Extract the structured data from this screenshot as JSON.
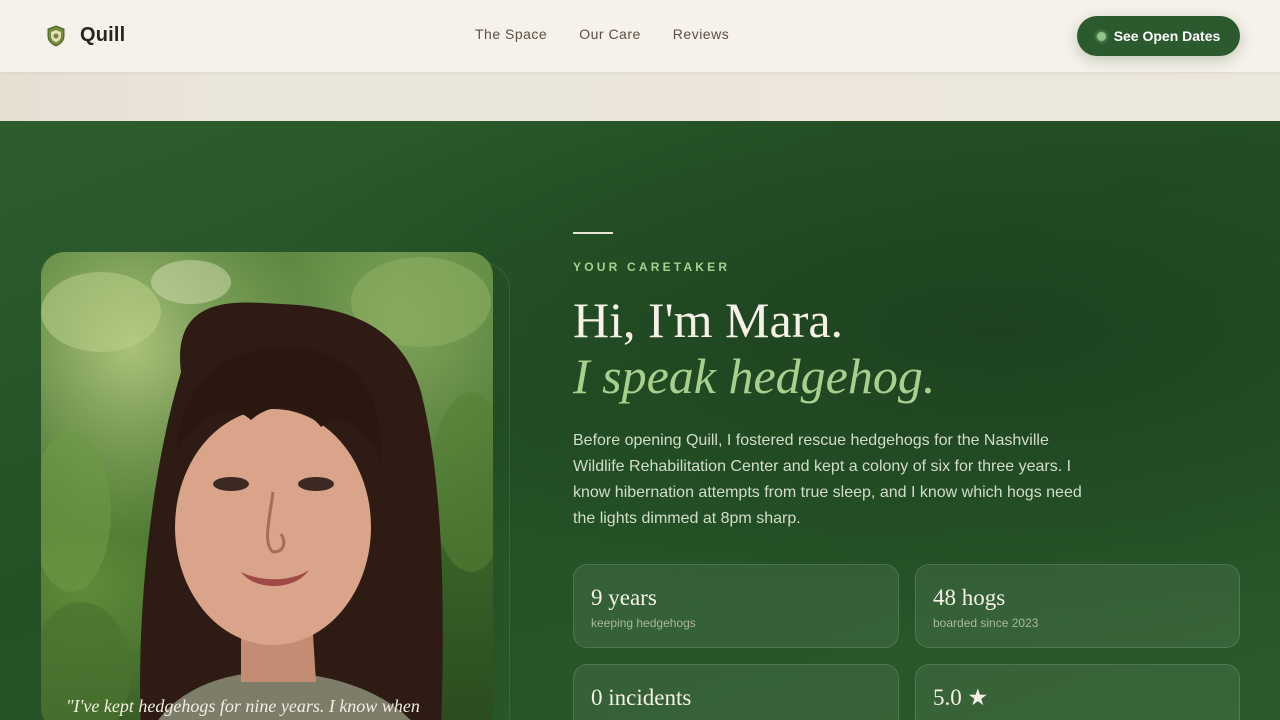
{
  "brand": {
    "name": "Quill"
  },
  "nav": {
    "items": [
      "The Space",
      "Our Care",
      "Reviews"
    ]
  },
  "cta": {
    "label": "See Open Dates"
  },
  "caretaker": {
    "eyebrow": "YOUR CARETAKER",
    "headline": "Hi, I'm Mara.",
    "headline_accent": "I speak hedgehog.",
    "bio": "Before opening Quill, I fostered rescue hedgehogs for the Nashville Wildlife Rehabilitation Center and kept a colony of six for three years. I know hibernation attempts from true sleep, and I know which hogs need the lights dimmed at 8pm sharp.",
    "quote": "\"I've kept hedgehogs for nine years. I know when",
    "stats": [
      {
        "value": "9 years",
        "label": "keeping hedgehogs"
      },
      {
        "value": "48 hogs",
        "label": "boarded since 2023"
      },
      {
        "value": "0 incidents",
        "label": ""
      },
      {
        "value": "5.0 ★",
        "label": ""
      }
    ]
  },
  "colors": {
    "accent_green": "#2c5a2f",
    "light_green": "#a8cf8e",
    "cream": "#f6f1ea"
  }
}
